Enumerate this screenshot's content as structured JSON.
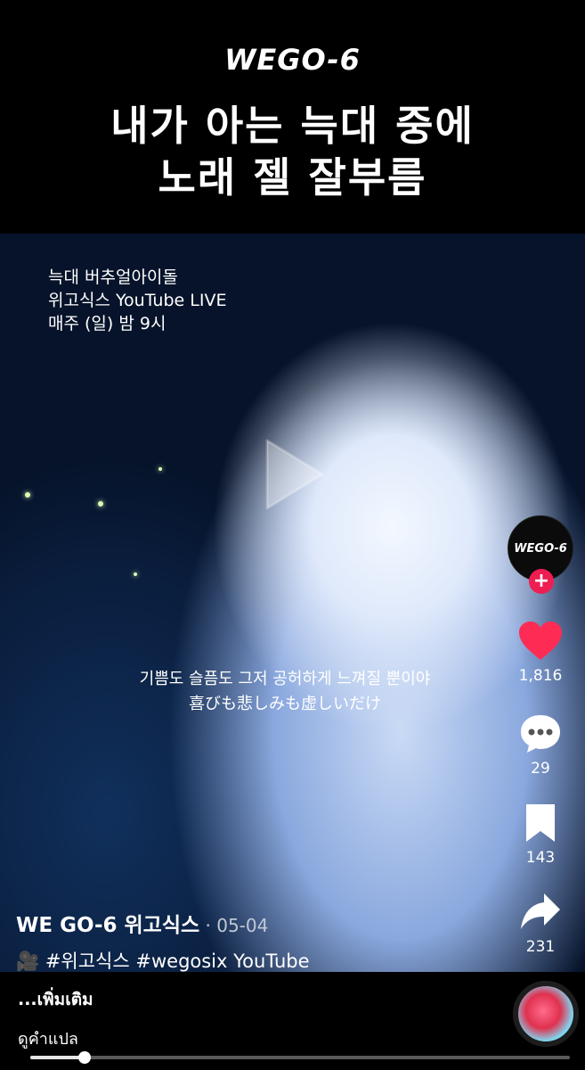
{
  "banner": {
    "logo_text": "WEGO-6",
    "headline_line1": "내가 아는 늑대 중에",
    "headline_line2": "노래 젤 잘부름"
  },
  "video": {
    "info_line1": "늑대 버추얼아이돌",
    "info_line2": "위고식스 YouTube LIVE",
    "info_line3": "매주 (일) 밤 9시",
    "subtitle_ko": "기쁨도 슬픔도 그저 공허하게 느껴질 뿐이야",
    "subtitle_ja": "喜びも悲しみも虚しいだけ"
  },
  "rail": {
    "avatar_text": "WEGO-6",
    "follow_symbol": "+",
    "likes": "1,816",
    "comments": "29",
    "saves": "143",
    "shares": "231"
  },
  "meta": {
    "author": "WE GO-6 위고식스",
    "date": " · 05-04",
    "tags": "🎥 #위고식스 #wegosix YouTube"
  },
  "bottom": {
    "more_label": "...เพิ่มเติม",
    "translate_label": "ดูคำแปล"
  },
  "progress": {
    "fraction": 0.1
  },
  "colors": {
    "like": "#fe2c55",
    "follow": "#ee1d52"
  }
}
